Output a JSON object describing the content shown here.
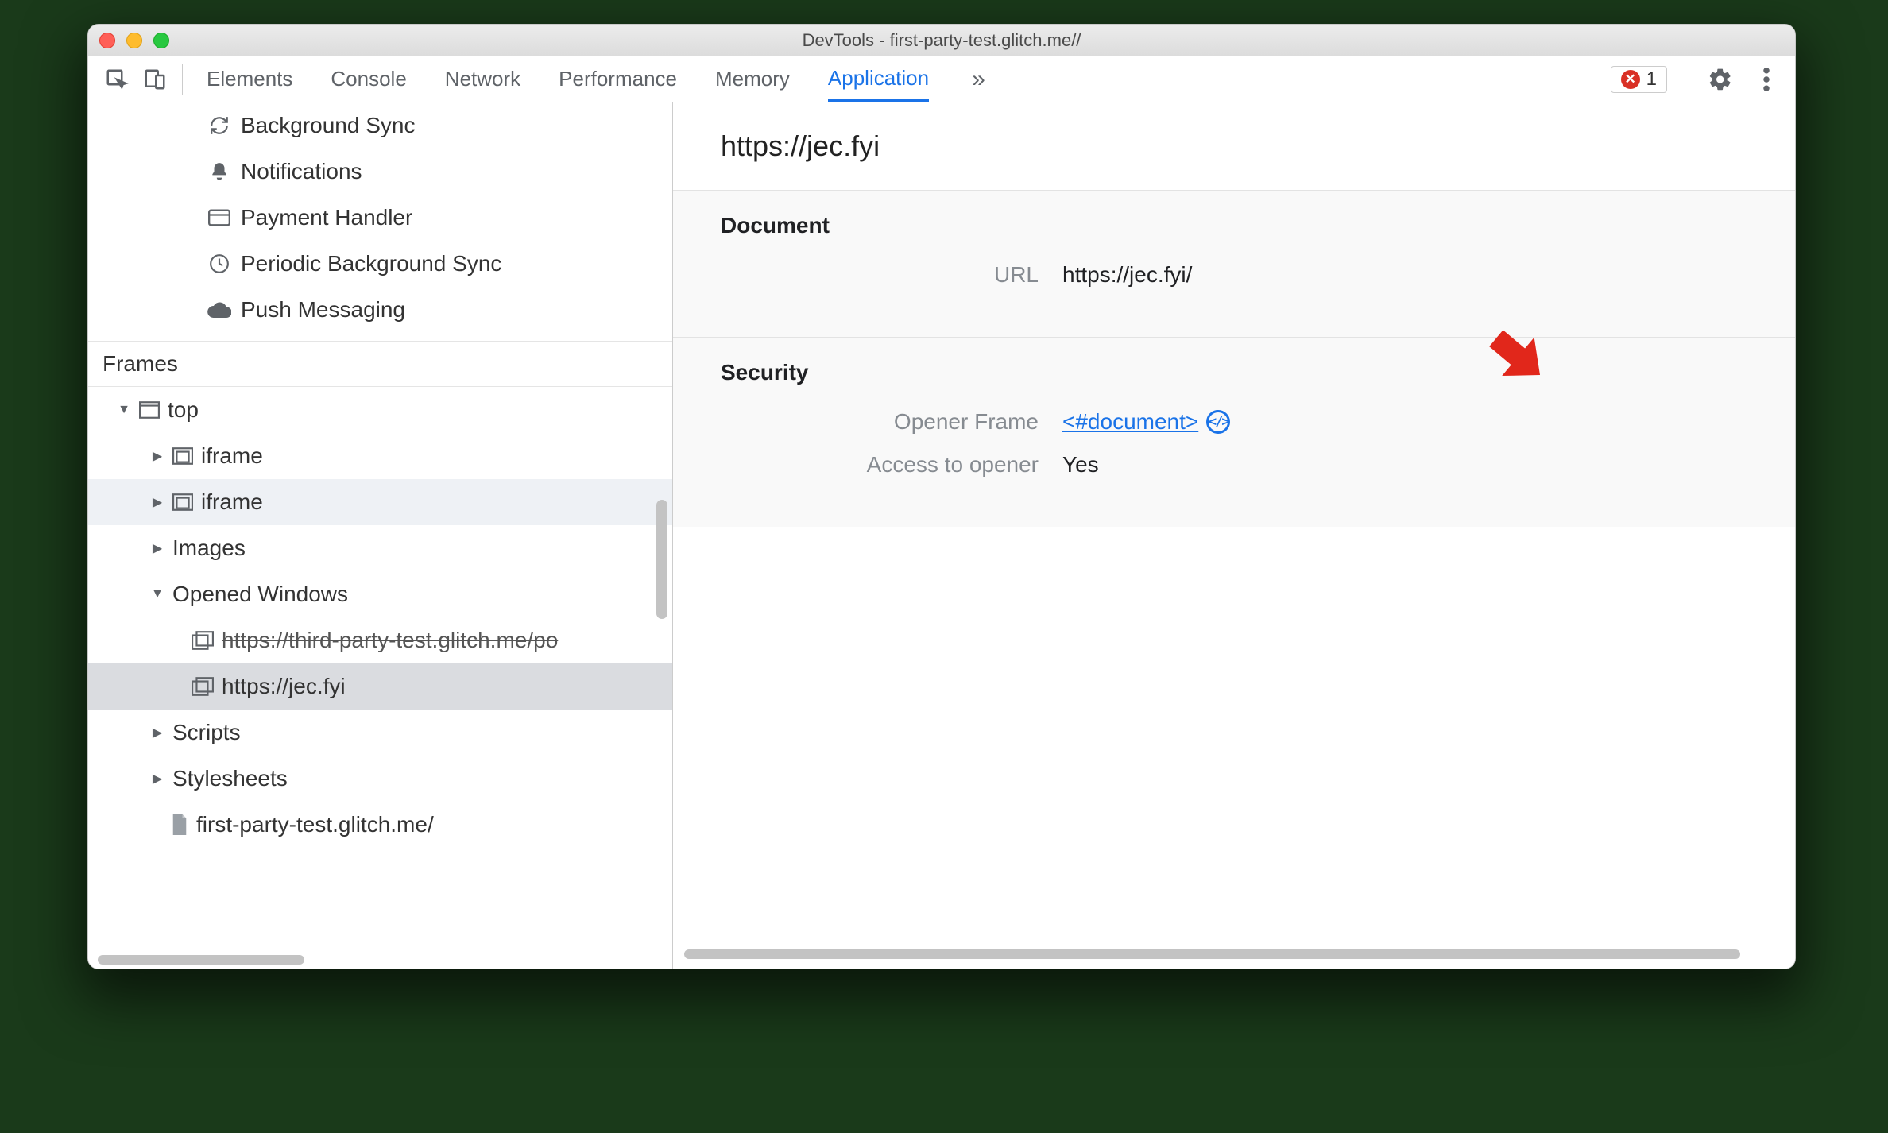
{
  "window": {
    "title": "DevTools - first-party-test.glitch.me//"
  },
  "toolbar": {
    "tabs": {
      "elements": "Elements",
      "console": "Console",
      "network": "Network",
      "performance": "Performance",
      "memory": "Memory",
      "application": "Application"
    },
    "more": "»",
    "error_count": "1"
  },
  "sidebar": {
    "bg_items": {
      "background_sync": "Background Sync",
      "notifications": "Notifications",
      "payment_handler": "Payment Handler",
      "periodic_bg_sync": "Periodic Background Sync",
      "push_messaging": "Push Messaging"
    },
    "frames_heading": "Frames",
    "tree": {
      "top": "top",
      "iframe1": "iframe",
      "iframe2": "iframe",
      "images": "Images",
      "opened_windows": "Opened Windows",
      "opened_w1": "https://third-party-test.glitch.me/po",
      "opened_w2": "https://jec.fyi",
      "scripts": "Scripts",
      "stylesheets": "Stylesheets",
      "doc": "first-party-test.glitch.me/"
    }
  },
  "content": {
    "title": "https://jec.fyi",
    "document": {
      "heading": "Document",
      "url_label": "URL",
      "url_value": "https://jec.fyi/"
    },
    "security": {
      "heading": "Security",
      "opener_frame_label": "Opener Frame",
      "opener_frame_value": "<#document>",
      "access_label": "Access to opener",
      "access_value": "Yes"
    }
  }
}
